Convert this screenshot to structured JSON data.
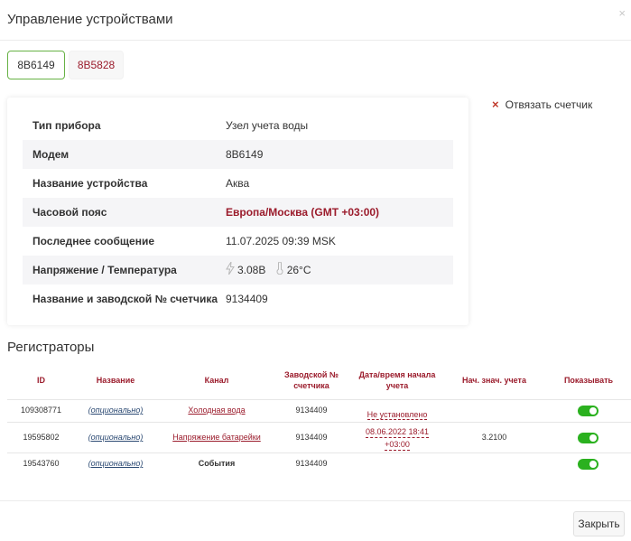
{
  "dialog": {
    "title": "Управление устройствами",
    "close_glyph": "×"
  },
  "tabs": [
    {
      "label": "8B6149"
    },
    {
      "label": "8B5828"
    }
  ],
  "info": {
    "rows": [
      {
        "label": "Тип прибора",
        "value": "Узел учета воды"
      },
      {
        "label": "Модем",
        "value": "8B6149"
      },
      {
        "label": "Название устройства",
        "value": "Аква"
      },
      {
        "label": "Часовой пояс",
        "value": "Европа/Москва (GMT +03:00)"
      },
      {
        "label": "Последнее сообщение",
        "value": "11.07.2025 09:39 MSK"
      },
      {
        "label": "Напряжение / Температура",
        "voltage": "3.08В",
        "temperature": "26°C"
      },
      {
        "label": "Название и заводской № счетчика",
        "value": "9134409"
      }
    ]
  },
  "unlink": {
    "icon": "×",
    "label": "Отвязать счетчик"
  },
  "registrators": {
    "title": "Регистраторы",
    "headers": {
      "id": "ID",
      "name": "Название",
      "channel": "Канал",
      "serial_1": "Заводской №",
      "serial_2": "счетчика",
      "start_1": "Дата/время начала",
      "start_2": "учета",
      "initial": "Нач. знач. учета",
      "show": "Показывать"
    },
    "rows": [
      {
        "id": "109308771",
        "name": "(опционально)",
        "channel": "Холодная вода",
        "serial": "9134409",
        "start_1": "Не установлено",
        "start_2": "",
        "initial": "",
        "show": true
      },
      {
        "id": "19595802",
        "name": "(опционально)",
        "channel": "Напряжение батарейки",
        "serial": "9134409",
        "start_1": "08.06.2022 18:41",
        "start_2": "+03:00",
        "initial": "3.2100",
        "show": true
      },
      {
        "id": "19543760",
        "name": "(опционально)",
        "channel": "События",
        "serial": "9134409",
        "start_1": "",
        "start_2": "",
        "initial": "",
        "show": true
      }
    ]
  },
  "footer": {
    "close_label": "Закрыть"
  },
  "colors": {
    "accent": "#9b1c2c",
    "toggle_on": "#2bb11f",
    "active_tab_border": "#67b245",
    "link_blue": "#2c4a73"
  },
  "icons": {
    "voltage": "lightning-icon",
    "temperature": "thermometer-icon"
  }
}
